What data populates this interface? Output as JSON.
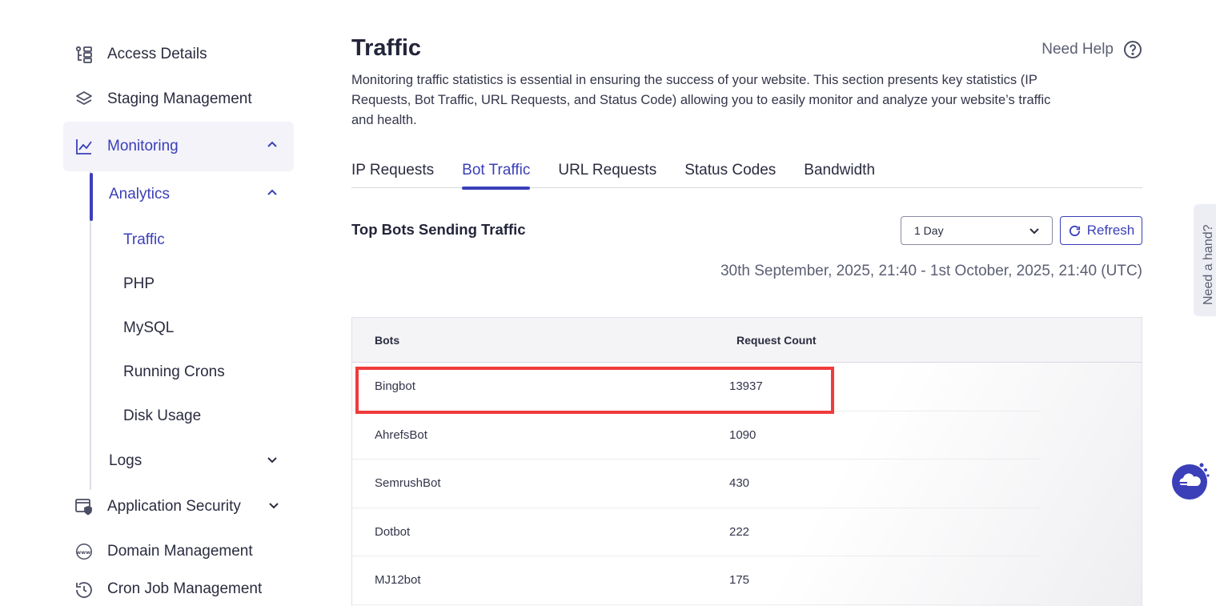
{
  "sidebar": {
    "items": [
      {
        "label": "Access Details",
        "icon": "access-details-icon"
      },
      {
        "label": "Staging Management",
        "icon": "layers-icon"
      },
      {
        "label": "Monitoring",
        "icon": "line-chart-icon"
      },
      {
        "label": "Application Security",
        "icon": "shield-window-icon"
      },
      {
        "label": "Domain Management",
        "icon": "www-icon"
      },
      {
        "label": "Cron Job Management",
        "icon": "history-icon"
      }
    ],
    "monitoring": {
      "analytics_label": "Analytics",
      "analytics_items": [
        "Traffic",
        "PHP",
        "MySQL",
        "Running Crons",
        "Disk Usage"
      ],
      "logs_label": "Logs"
    }
  },
  "main": {
    "title": "Traffic",
    "help_label": "Need Help",
    "description": "Monitoring traffic statistics is essential in ensuring the success of your website. This section presents key statistics (IP Requests, Bot Traffic, URL Requests, and Status Code) allowing you to easily monitor and analyze your website’s traffic and health.",
    "tabs": [
      "IP Requests",
      "Bot Traffic",
      "URL Requests",
      "Status Codes",
      "Bandwidth"
    ],
    "active_tab": "Bot Traffic",
    "section_title": "Top Bots Sending Traffic",
    "range_select": "1 Day",
    "refresh_label": "Refresh",
    "date_range": "30th September, 2025, 21:40 - 1st October, 2025, 21:40 (UTC)",
    "table": {
      "headers": [
        "Bots",
        "Request Count"
      ],
      "rows": [
        [
          "Bingbot",
          "13937"
        ],
        [
          "AhrefsBot",
          "1090"
        ],
        [
          "SemrushBot",
          "430"
        ],
        [
          "Dotbot",
          "222"
        ],
        [
          "MJ12bot",
          "175"
        ]
      ]
    }
  },
  "side_widget": {
    "label": "Need a hand?"
  },
  "colors": {
    "accent": "#3b3fb8",
    "highlight": "#ef3b3b",
    "text": "#2a2c3f"
  }
}
